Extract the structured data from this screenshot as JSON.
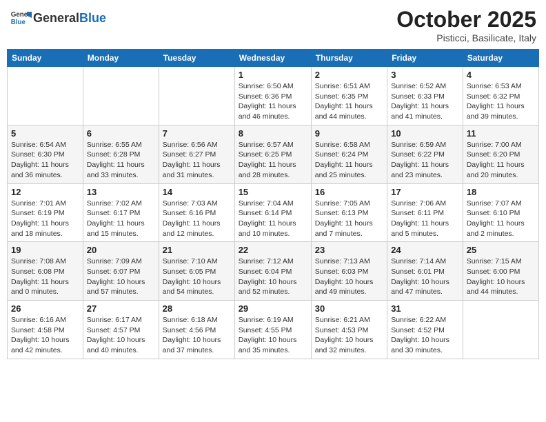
{
  "header": {
    "logo_general": "General",
    "logo_blue": "Blue",
    "month_title": "October 2025",
    "subtitle": "Pisticci, Basilicate, Italy"
  },
  "days_of_week": [
    "Sunday",
    "Monday",
    "Tuesday",
    "Wednesday",
    "Thursday",
    "Friday",
    "Saturday"
  ],
  "weeks": [
    [
      {
        "day": "",
        "info": ""
      },
      {
        "day": "",
        "info": ""
      },
      {
        "day": "",
        "info": ""
      },
      {
        "day": "1",
        "info": "Sunrise: 6:50 AM\nSunset: 6:36 PM\nDaylight: 11 hours and 46 minutes."
      },
      {
        "day": "2",
        "info": "Sunrise: 6:51 AM\nSunset: 6:35 PM\nDaylight: 11 hours and 44 minutes."
      },
      {
        "day": "3",
        "info": "Sunrise: 6:52 AM\nSunset: 6:33 PM\nDaylight: 11 hours and 41 minutes."
      },
      {
        "day": "4",
        "info": "Sunrise: 6:53 AM\nSunset: 6:32 PM\nDaylight: 11 hours and 39 minutes."
      }
    ],
    [
      {
        "day": "5",
        "info": "Sunrise: 6:54 AM\nSunset: 6:30 PM\nDaylight: 11 hours and 36 minutes."
      },
      {
        "day": "6",
        "info": "Sunrise: 6:55 AM\nSunset: 6:28 PM\nDaylight: 11 hours and 33 minutes."
      },
      {
        "day": "7",
        "info": "Sunrise: 6:56 AM\nSunset: 6:27 PM\nDaylight: 11 hours and 31 minutes."
      },
      {
        "day": "8",
        "info": "Sunrise: 6:57 AM\nSunset: 6:25 PM\nDaylight: 11 hours and 28 minutes."
      },
      {
        "day": "9",
        "info": "Sunrise: 6:58 AM\nSunset: 6:24 PM\nDaylight: 11 hours and 25 minutes."
      },
      {
        "day": "10",
        "info": "Sunrise: 6:59 AM\nSunset: 6:22 PM\nDaylight: 11 hours and 23 minutes."
      },
      {
        "day": "11",
        "info": "Sunrise: 7:00 AM\nSunset: 6:20 PM\nDaylight: 11 hours and 20 minutes."
      }
    ],
    [
      {
        "day": "12",
        "info": "Sunrise: 7:01 AM\nSunset: 6:19 PM\nDaylight: 11 hours and 18 minutes."
      },
      {
        "day": "13",
        "info": "Sunrise: 7:02 AM\nSunset: 6:17 PM\nDaylight: 11 hours and 15 minutes."
      },
      {
        "day": "14",
        "info": "Sunrise: 7:03 AM\nSunset: 6:16 PM\nDaylight: 11 hours and 12 minutes."
      },
      {
        "day": "15",
        "info": "Sunrise: 7:04 AM\nSunset: 6:14 PM\nDaylight: 11 hours and 10 minutes."
      },
      {
        "day": "16",
        "info": "Sunrise: 7:05 AM\nSunset: 6:13 PM\nDaylight: 11 hours and 7 minutes."
      },
      {
        "day": "17",
        "info": "Sunrise: 7:06 AM\nSunset: 6:11 PM\nDaylight: 11 hours and 5 minutes."
      },
      {
        "day": "18",
        "info": "Sunrise: 7:07 AM\nSunset: 6:10 PM\nDaylight: 11 hours and 2 minutes."
      }
    ],
    [
      {
        "day": "19",
        "info": "Sunrise: 7:08 AM\nSunset: 6:08 PM\nDaylight: 11 hours and 0 minutes."
      },
      {
        "day": "20",
        "info": "Sunrise: 7:09 AM\nSunset: 6:07 PM\nDaylight: 10 hours and 57 minutes."
      },
      {
        "day": "21",
        "info": "Sunrise: 7:10 AM\nSunset: 6:05 PM\nDaylight: 10 hours and 54 minutes."
      },
      {
        "day": "22",
        "info": "Sunrise: 7:12 AM\nSunset: 6:04 PM\nDaylight: 10 hours and 52 minutes."
      },
      {
        "day": "23",
        "info": "Sunrise: 7:13 AM\nSunset: 6:03 PM\nDaylight: 10 hours and 49 minutes."
      },
      {
        "day": "24",
        "info": "Sunrise: 7:14 AM\nSunset: 6:01 PM\nDaylight: 10 hours and 47 minutes."
      },
      {
        "day": "25",
        "info": "Sunrise: 7:15 AM\nSunset: 6:00 PM\nDaylight: 10 hours and 44 minutes."
      }
    ],
    [
      {
        "day": "26",
        "info": "Sunrise: 6:16 AM\nSunset: 4:58 PM\nDaylight: 10 hours and 42 minutes."
      },
      {
        "day": "27",
        "info": "Sunrise: 6:17 AM\nSunset: 4:57 PM\nDaylight: 10 hours and 40 minutes."
      },
      {
        "day": "28",
        "info": "Sunrise: 6:18 AM\nSunset: 4:56 PM\nDaylight: 10 hours and 37 minutes."
      },
      {
        "day": "29",
        "info": "Sunrise: 6:19 AM\nSunset: 4:55 PM\nDaylight: 10 hours and 35 minutes."
      },
      {
        "day": "30",
        "info": "Sunrise: 6:21 AM\nSunset: 4:53 PM\nDaylight: 10 hours and 32 minutes."
      },
      {
        "day": "31",
        "info": "Sunrise: 6:22 AM\nSunset: 4:52 PM\nDaylight: 10 hours and 30 minutes."
      },
      {
        "day": "",
        "info": ""
      }
    ]
  ]
}
